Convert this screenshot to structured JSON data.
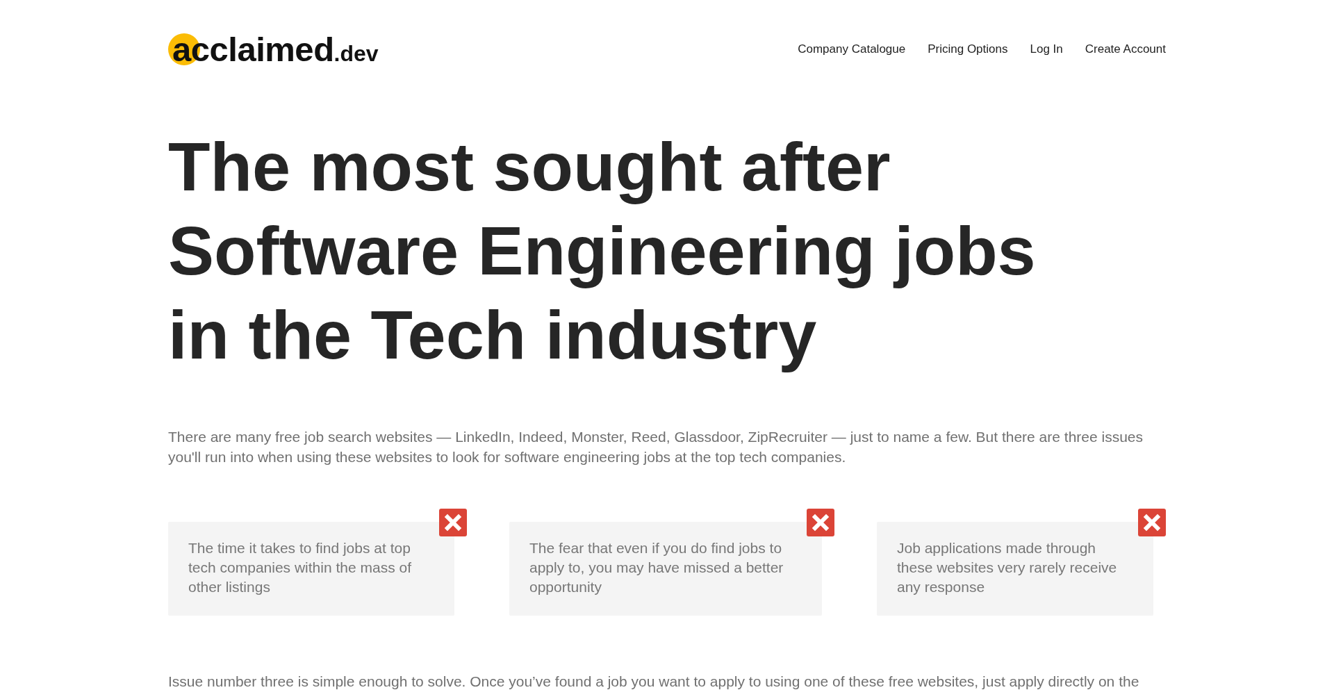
{
  "header": {
    "logo": {
      "name": "acclaimed",
      "domain": ".dev"
    },
    "nav_links": [
      "Company Catalogue",
      "Pricing Options",
      "Log In",
      "Create Account"
    ]
  },
  "hero": {
    "heading": "The most sought after Software Engineering jobs in the Tech industry"
  },
  "intro": "There are many free job search websites — LinkedIn, Indeed, Monster, Reed, Glassdoor, ZipRecruiter — just to name a few. But there are three issues you'll run into when using these websites to look for software engineering jobs at the top tech companies.",
  "issues": [
    {
      "text": "The time it takes to find jobs at top tech companies within the mass of other listings"
    },
    {
      "text": "The fear that even if you do find jobs to apply to, you may have missed a better opportunity"
    },
    {
      "text": "Job applications made through these websites very rarely receive any response"
    }
  ],
  "next_paragraph": "Issue number three is simple enough to solve. Once you’ve found a job you want to apply to using one of these free websites, just apply directly on the"
}
